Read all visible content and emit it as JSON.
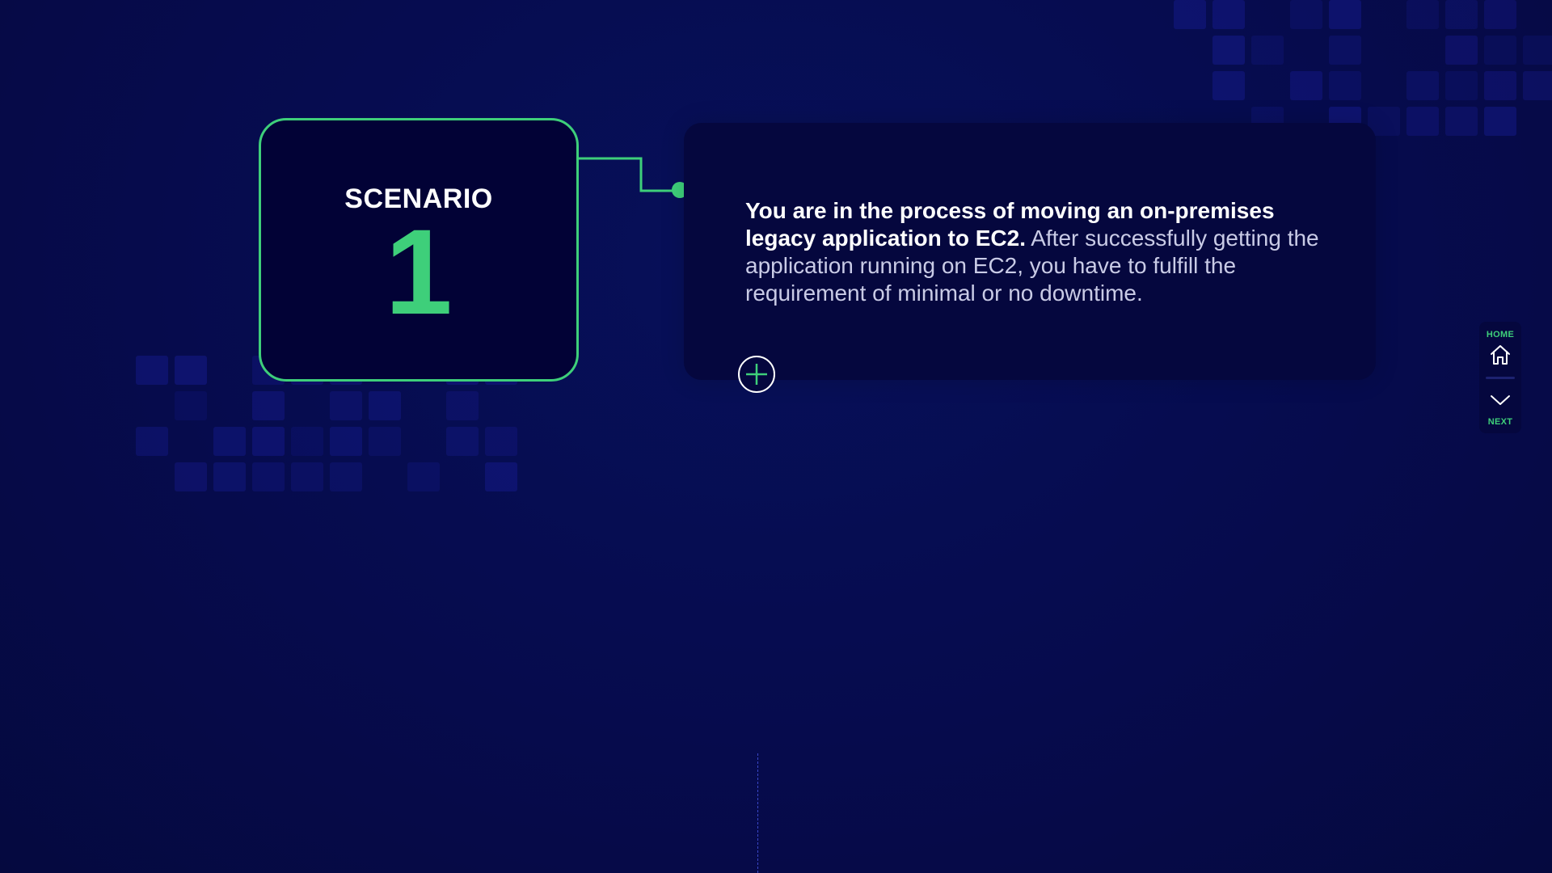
{
  "scenario": {
    "label": "SCENARIO",
    "number": "1"
  },
  "description": {
    "bold_text": "You are in the process of moving an on-premises legacy application to EC2.",
    "body_text": " After successfully getting the application running on EC2, you have to fulfill the requirement of minimal or no downtime."
  },
  "nav": {
    "home_label": "HOME",
    "next_label": "NEXT"
  },
  "icons": {
    "expand": "plus-icon",
    "home": "home-icon",
    "next": "chevron-down-icon"
  },
  "colors": {
    "accent": "#3ecf7a",
    "background": "#060b4d",
    "card": "#020236",
    "panel": "#05073e"
  }
}
